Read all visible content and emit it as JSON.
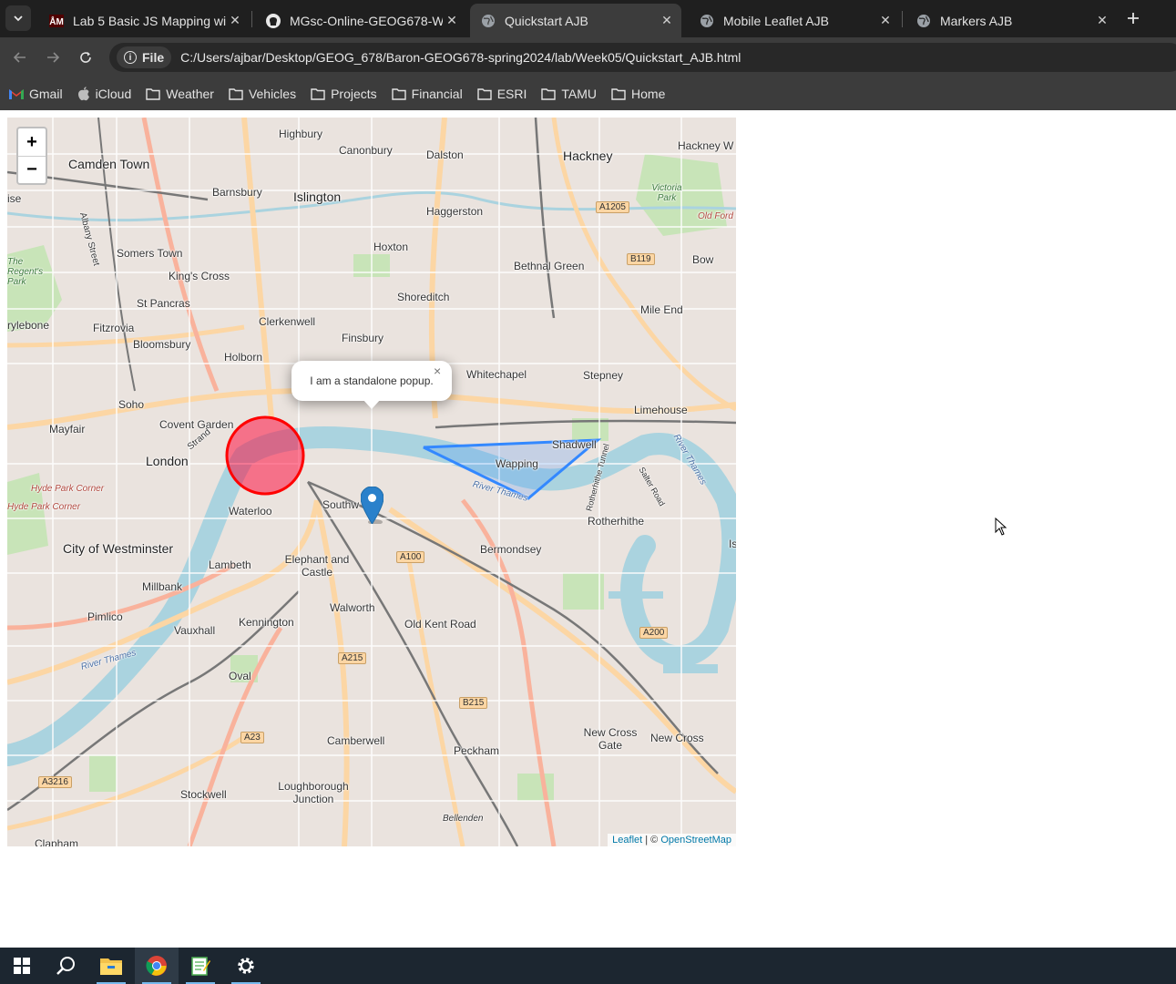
{
  "browser": {
    "tabs": [
      {
        "title": "Lab 5 Basic JS Mapping with",
        "favicon": "tamu-icon",
        "active": false
      },
      {
        "title": "MGsc-Online-GEOG678-W",
        "favicon": "github-icon",
        "active": false
      },
      {
        "title": "Quickstart AJB",
        "favicon": "globe-icon",
        "active": true
      },
      {
        "title": "Mobile Leaflet AJB",
        "favicon": "globe-icon",
        "active": false
      },
      {
        "title": "Markers AJB",
        "favicon": "globe-icon",
        "active": false
      }
    ],
    "site_chip": "File",
    "url": "C:/Users/ajbar/Desktop/GEOG_678/Baron-GEOG678-spring2024/lab/Week05/Quickstart_AJB.html",
    "bookmarks": [
      "Gmail",
      "iCloud",
      "Weather",
      "Vehicles",
      "Projects",
      "Financial",
      "ESRI",
      "TAMU",
      "Home"
    ]
  },
  "map": {
    "zoom_in": "+",
    "zoom_out": "−",
    "popup_text": "I am a standalone popup.",
    "popup_close": "×",
    "attribution": {
      "leaflet": "Leaflet",
      "sep": " | © ",
      "osm": "OpenStreetMap"
    },
    "circle_color": "#ff0000",
    "polygon_color": "#3388ff",
    "marker_color": "#2a81cb",
    "places": {
      "highbury": "Highbury",
      "canonbury": "Canonbury",
      "dalston": "Dalston",
      "hackney": "Hackney",
      "hackney_w": "Hackney W",
      "camden_town": "Camden Town",
      "barnsbury": "Barnsbury",
      "islington": "Islington",
      "haggerston": "Haggerston",
      "victoria_park": "Victoria Park",
      "old_ford": "Old Ford",
      "somers_town": "Somers Town",
      "hoxton": "Hoxton",
      "bethnal_green": "Bethnal Green",
      "bow": "Bow",
      "kings_cross": "King's Cross",
      "regents_park": "The Regent's Park",
      "st_pancras": "St Pancras",
      "shoreditch": "Shoreditch",
      "clerkenwell": "Clerkenwell",
      "mile_end": "Mile End",
      "fitzrovia": "Fitzrovia",
      "marylebone": "rylebone",
      "bloomsbury": "Bloomsbury",
      "finsbury": "Finsbury",
      "holborn": "Holborn",
      "whitechapel": "Whitechapel",
      "stepney": "Stepney",
      "soho": "Soho",
      "limehouse": "Limehouse",
      "mayfair": "Mayfair",
      "covent_garden": "Covent Garden",
      "shadwell": "Shadwell",
      "london": "London",
      "wapping": "Wapping",
      "hyde_park_corner": "Hyde Park Corner",
      "southwark": "Southw",
      "waterloo": "Waterloo",
      "rotherhithe": "Rotherhithe",
      "city_westminster": "City of Westminster",
      "bermondsey": "Bermondsey",
      "lambeth": "Lambeth",
      "elephant_castle": "Elephant and Castle",
      "millbank": "Millbank",
      "walworth": "Walworth",
      "pimlico": "Pimlico",
      "kennington": "Kennington",
      "old_kent_road": "Old Kent Road",
      "vauxhall": "Vauxhall",
      "oval": "Oval",
      "new_cross_gate": "New Cross Gate",
      "new_cross": "New Cross",
      "camberwell": "Camberwell",
      "peckham": "Peckham",
      "loughborough": "Loughborough Junction",
      "stockwell": "Stockwell",
      "bellenden": "Bellenden",
      "clapham": "Clapham",
      "river_thames": "River Thames",
      "strand": "Strand",
      "albany_street": "Albany Street",
      "salter_road": "Salter Road",
      "rotherhithe_tunnel": "Rotherhithe Tunnel",
      "isle": "Is",
      "ise": "ise"
    },
    "roads": {
      "a1205": "A1205",
      "b119": "B119",
      "a100": "A100",
      "a215": "A215",
      "b215": "B215",
      "a200": "A200",
      "a23": "A23",
      "a3216": "A3216"
    }
  },
  "taskbar": {
    "items": [
      {
        "name": "start-button",
        "icon": "windows-icon"
      },
      {
        "name": "search-button",
        "icon": "search-icon"
      },
      {
        "name": "file-explorer-button",
        "icon": "folder-icon"
      },
      {
        "name": "chrome-button",
        "icon": "chrome-icon"
      },
      {
        "name": "notepad-button",
        "icon": "notepad-icon"
      },
      {
        "name": "settings-button",
        "icon": "gear-icon"
      }
    ]
  }
}
